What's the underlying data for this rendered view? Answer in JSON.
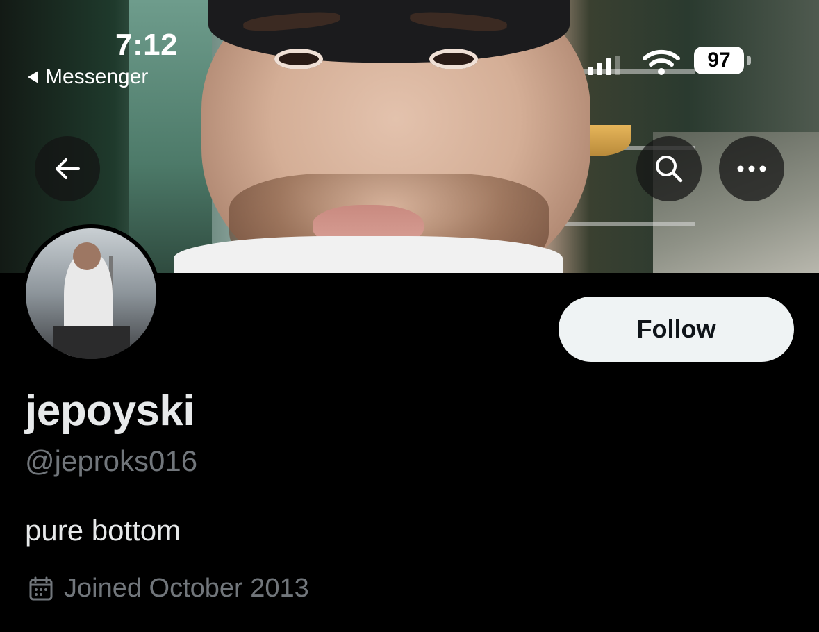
{
  "status_bar": {
    "time": "7:12",
    "back_app": "Messenger",
    "battery": "97"
  },
  "nav": {
    "back_icon": "arrow-left-icon",
    "search_icon": "search-icon",
    "more_icon": "more-dots-icon"
  },
  "profile": {
    "display_name": "jepoyski",
    "handle": "@jeproks016",
    "bio": "pure bottom",
    "joined": "Joined October 2013",
    "follow_label": "Follow"
  },
  "colors": {
    "background": "#000000",
    "primary_text": "#e7e9ea",
    "secondary_text": "#71767b",
    "follow_button_bg": "#eff3f4"
  }
}
